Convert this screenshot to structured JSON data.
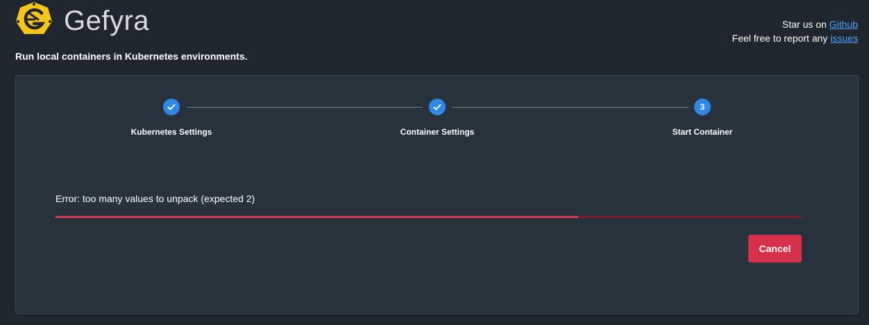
{
  "app": {
    "brand": "Gefyra",
    "tagline": "Run local containers in Kubernetes environments.",
    "logo_icon": "gefyra-logo-icon",
    "logo_color": "#f5c518"
  },
  "header": {
    "star_prefix": "Star us on ",
    "star_link": "Github",
    "report_prefix": "Feel free to report any ",
    "report_link": "issues",
    "link_color": "#4ea1ff"
  },
  "stepper": {
    "steps": [
      {
        "label": "Kubernetes Settings",
        "state": "completed",
        "icon": "check-icon"
      },
      {
        "label": "Container Settings",
        "state": "completed",
        "icon": "check-icon"
      },
      {
        "label": "Start Container",
        "state": "active",
        "number": "3"
      }
    ],
    "accent_color": "#2f87e6"
  },
  "status": {
    "error_message": "Error: too many values to unpack (expected 2)",
    "progress_fraction": 0.7
  },
  "actions": {
    "cancel_label": "Cancel",
    "cancel_color": "#d6304a"
  }
}
